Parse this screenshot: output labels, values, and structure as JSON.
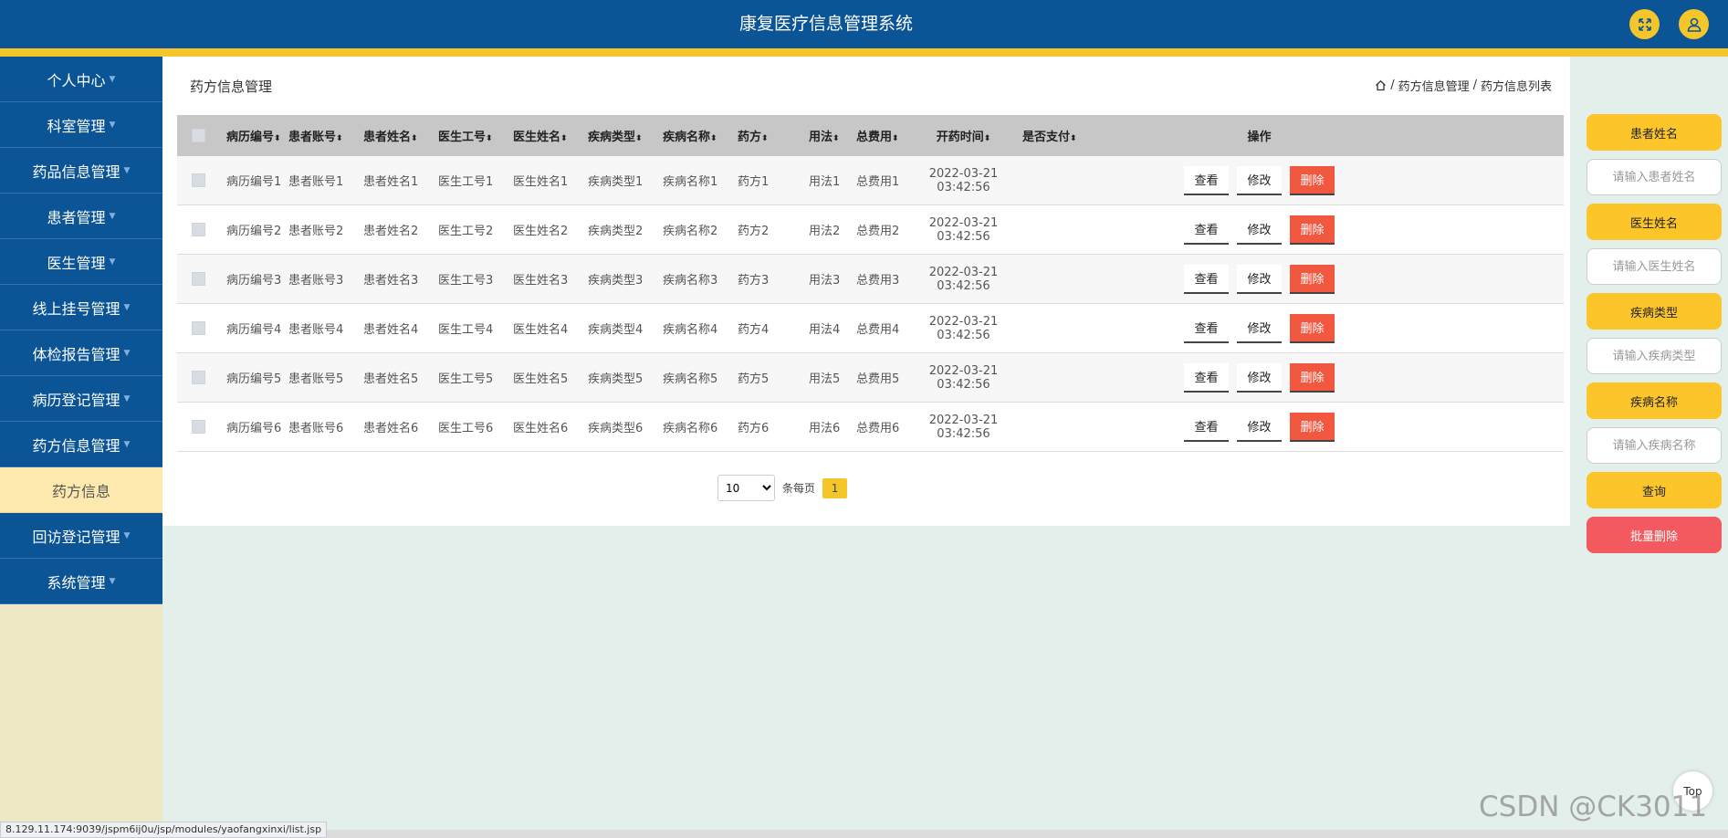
{
  "header": {
    "title": "康复医疗信息管理系统",
    "fullscreen_icon": "expand-icon",
    "user_icon": "user-icon"
  },
  "sidebar": {
    "items": [
      {
        "label": "个人中心"
      },
      {
        "label": "科室管理"
      },
      {
        "label": "药品信息管理"
      },
      {
        "label": "患者管理"
      },
      {
        "label": "医生管理"
      },
      {
        "label": "线上挂号管理"
      },
      {
        "label": "体检报告管理"
      },
      {
        "label": "病历登记管理"
      },
      {
        "label": "药方信息管理"
      },
      {
        "label": "药方信息",
        "submenu": true
      },
      {
        "label": "回访登记管理"
      },
      {
        "label": "系统管理"
      }
    ]
  },
  "page": {
    "title": "药方信息管理",
    "breadcrumb": [
      "药方信息管理",
      "药方信息列表"
    ],
    "breadcrumb_sep": "/"
  },
  "table": {
    "columns": [
      "病历编号",
      "患者账号",
      "患者姓名",
      "医生工号",
      "医生姓名",
      "疾病类型",
      "疾病名称",
      "药方",
      "用法",
      "总费用",
      "开药时间",
      "是否支付",
      "操作"
    ],
    "rows": [
      [
        "病历编号1",
        "患者账号1",
        "患者姓名1",
        "医生工号1",
        "医生姓名1",
        "疾病类型1",
        "疾病名称1",
        "药方1",
        "用法1",
        "总费用1",
        "2022-03-21 03:42:56",
        ""
      ],
      [
        "病历编号2",
        "患者账号2",
        "患者姓名2",
        "医生工号2",
        "医生姓名2",
        "疾病类型2",
        "疾病名称2",
        "药方2",
        "用法2",
        "总费用2",
        "2022-03-21 03:42:56",
        ""
      ],
      [
        "病历编号3",
        "患者账号3",
        "患者姓名3",
        "医生工号3",
        "医生姓名3",
        "疾病类型3",
        "疾病名称3",
        "药方3",
        "用法3",
        "总费用3",
        "2022-03-21 03:42:56",
        ""
      ],
      [
        "病历编号4",
        "患者账号4",
        "患者姓名4",
        "医生工号4",
        "医生姓名4",
        "疾病类型4",
        "疾病名称4",
        "药方4",
        "用法4",
        "总费用4",
        "2022-03-21 03:42:56",
        ""
      ],
      [
        "病历编号5",
        "患者账号5",
        "患者姓名5",
        "医生工号5",
        "医生姓名5",
        "疾病类型5",
        "疾病名称5",
        "药方5",
        "用法5",
        "总费用5",
        "2022-03-21 03:42:56",
        ""
      ],
      [
        "病历编号6",
        "患者账号6",
        "患者姓名6",
        "医生工号6",
        "医生姓名6",
        "疾病类型6",
        "疾病名称6",
        "药方6",
        "用法6",
        "总费用6",
        "2022-03-21 03:42:56",
        ""
      ]
    ],
    "actions": {
      "view": "查看",
      "edit": "修改",
      "delete": "删除"
    }
  },
  "pagination": {
    "page_size": "10",
    "page_size_options": [
      "10"
    ],
    "per_page_label": "条每页",
    "current_page": "1"
  },
  "search_panel": {
    "fields": [
      {
        "label": "患者姓名",
        "placeholder": "请输入患者姓名"
      },
      {
        "label": "医生姓名",
        "placeholder": "请输入医生姓名"
      },
      {
        "label": "疾病类型",
        "placeholder": "请输入疾病类型"
      },
      {
        "label": "疾病名称",
        "placeholder": "请输入疾病名称"
      }
    ],
    "query_label": "查询",
    "batch_delete_label": "批量删除"
  },
  "misc": {
    "top_label": "Top",
    "status_url": "8.129.11.174:9039/jspm6ij0u/jsp/modules/yaofangxinxi/list.jsp",
    "watermark": "CSDN @CK3011"
  },
  "colors": {
    "header_bg": "#0b5597",
    "accent_yellow": "#f4c62a",
    "delete_red": "#f2583f",
    "batch_delete_red": "#f25a5f"
  }
}
